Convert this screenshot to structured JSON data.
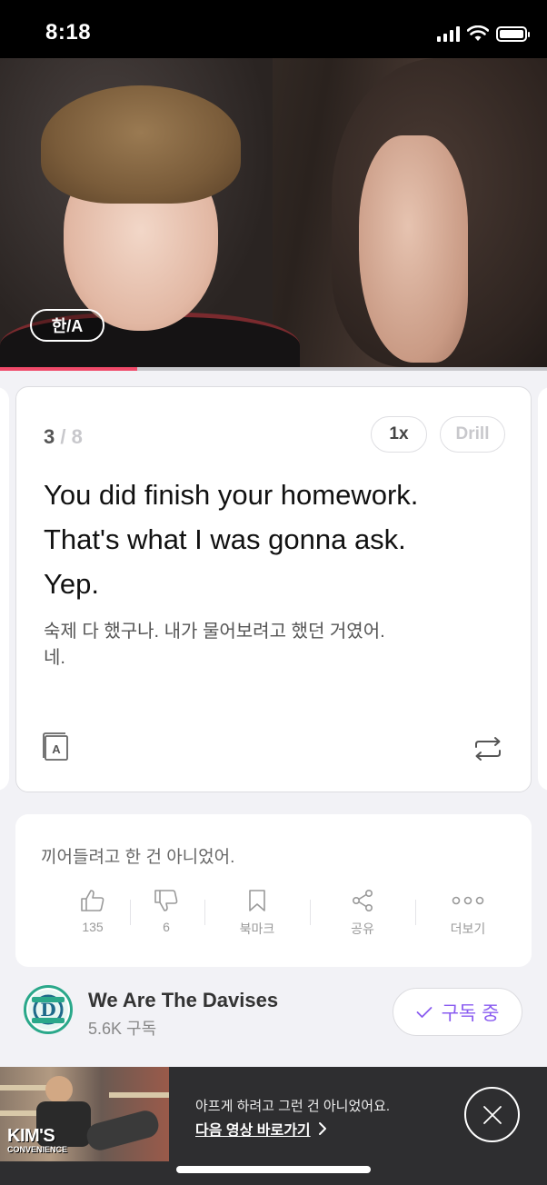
{
  "status_bar": {
    "time": "8:18"
  },
  "video": {
    "subtitle_toggle": "한/A",
    "progress": 0.25,
    "progress_color": "#f04a6a"
  },
  "card": {
    "current": "3",
    "separator": " / ",
    "total": "8",
    "speed": "1x",
    "drill": "Drill",
    "english": [
      "You did finish your homework.",
      "That's what I was gonna ask.",
      "Yep."
    ],
    "korean": [
      "숙제 다 했구나. 내가 물어보려고 했던 거였어.",
      "네."
    ],
    "dictionary_icon": "dictionary-icon",
    "repeat_icon": "repeat-icon"
  },
  "panel": {
    "comment": "끼어들려고 한 건 아니었어.",
    "actions": [
      {
        "icon": "thumbs-up-icon",
        "label": "135"
      },
      {
        "icon": "thumbs-down-icon",
        "label": "6"
      },
      {
        "icon": "bookmark-icon",
        "label": "북마크"
      },
      {
        "icon": "share-icon",
        "label": "공유"
      },
      {
        "icon": "more-icon",
        "label": "더보기"
      }
    ]
  },
  "channel": {
    "name": "We Are The Davises",
    "subscribers": "5.6K 구독",
    "subscribe_label": "구독 중",
    "accent": "#8a5cf0"
  },
  "banner": {
    "thumb_title": "KIM'S",
    "thumb_subtitle": "CONVENIENCE",
    "text": "아프게 하려고 그런 건 아니었어요.",
    "link": "다음 영상 바로가기"
  }
}
